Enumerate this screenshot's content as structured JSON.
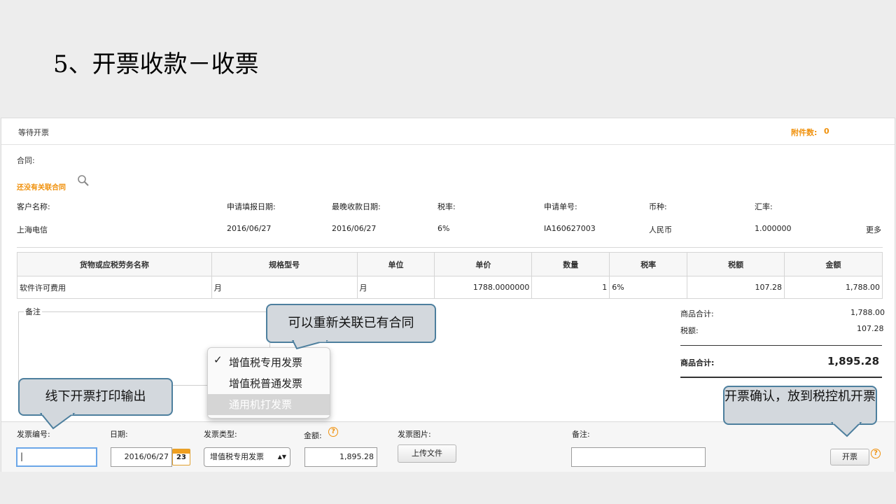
{
  "slide": {
    "title": "5、开票收款－收票"
  },
  "panel": {
    "status": "等待开票",
    "attachments_label": "附件数:",
    "attachments_count": "0",
    "contract_label": "合同:",
    "no_contract": "还没有关联合同"
  },
  "info": {
    "labels": [
      "客户名称:",
      "申请填报日期:",
      "最晚收款日期:",
      "税率:",
      "申请单号:",
      "币种:",
      "汇率:"
    ],
    "values": [
      "上海电信",
      "2016/06/27",
      "2016/06/27",
      "6%",
      "IA160627003",
      "人民币",
      "1.000000"
    ],
    "more": "更多"
  },
  "goods_table": {
    "headers": [
      "货物或应税劳务名称",
      "规格型号",
      "单位",
      "单价",
      "数量",
      "税率",
      "税额",
      "金额"
    ],
    "rows": [
      [
        "软件许可费用",
        "月",
        "月",
        "1788.0000000",
        "1",
        "6%",
        "107.28",
        "1,788.00"
      ]
    ]
  },
  "remarks_label": "备注",
  "summary": {
    "subtotal_label": "商品合计:",
    "subtotal_value": "1,788.00",
    "tax_label": "税额:",
    "tax_value": "107.28",
    "total_label": "商品合计:",
    "total_value": "1,895.28"
  },
  "invoice_type_menu": {
    "options": [
      "增值税专用发票",
      "增值税普通发票",
      "通用机打发票"
    ],
    "selected_mark": "✓"
  },
  "form": {
    "invoice_no_label": "发票编号:",
    "invoice_no_value": "|",
    "date_label": "日期:",
    "date_value": "2016/06/27",
    "calendar_day": "23",
    "type_label": "发票类型:",
    "type_value": "增值税专用发票",
    "amount_label": "金额:",
    "amount_value": "1,895.28",
    "image_label": "发票图片:",
    "upload_button": "上传文件",
    "note_label": "备注:",
    "issue_button": "开票",
    "help_mark": "?"
  },
  "callouts": {
    "relink": "可以重新关联已有合同",
    "offline_print": "线下开票打印输出",
    "confirm": "开票确认，放到税控机开票"
  },
  "colors": {
    "accent": "#f0910c",
    "callout_border": "#4d7f9e",
    "callout_fill": "#d3d8dd"
  }
}
